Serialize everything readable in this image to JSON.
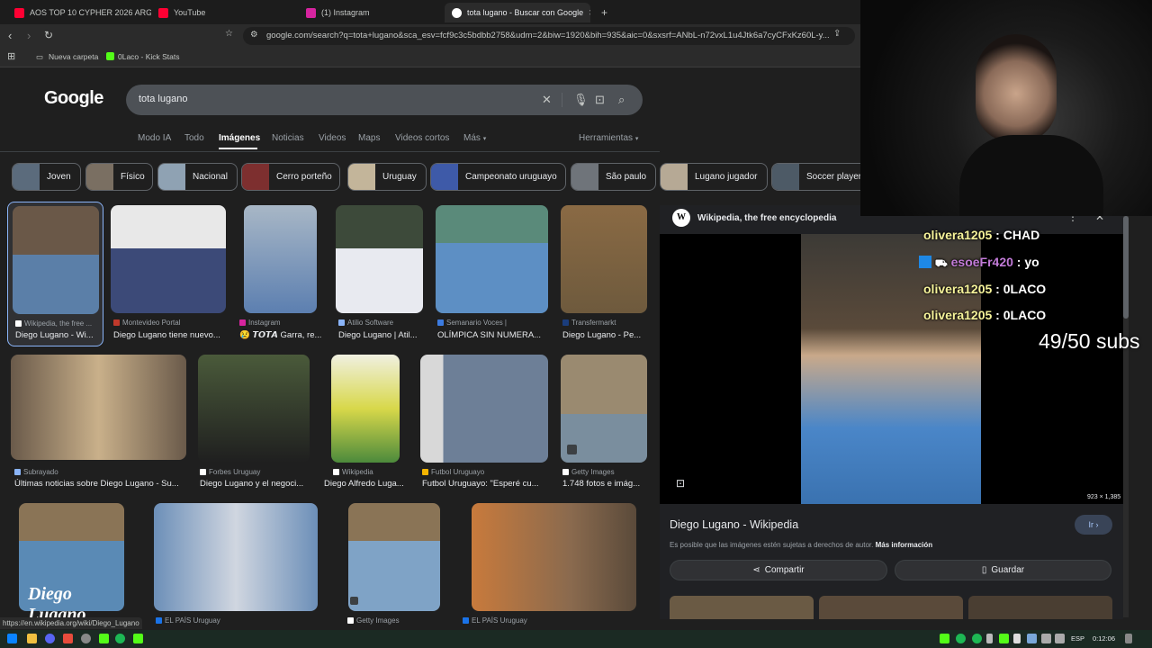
{
  "browser": {
    "tabs": [
      {
        "label": "AOS TOP 10 CYPHER 2026 ARG - You",
        "color": "#ff0033"
      },
      {
        "label": "YouTube",
        "color": "#ff0033"
      },
      {
        "label": "(1) Instagram",
        "color": "#d6249f"
      },
      {
        "label": "tota lugano - Buscar con Google",
        "color": "#ffffff"
      }
    ],
    "new_tab_icon": "+",
    "close_tab_icon": "✕",
    "url": "google.com/search?q=tota+lugano&sca_esv=fcf9c3c5bdbb2758&udm=2&biw=1920&bih=935&aic=0&sxsrf=ANbL-n72vxL1u4Jtk6a7cyCFxKz60L-y...",
    "bookmarks": [
      "Nueva carpeta",
      "0Laco - Kick Stats"
    ]
  },
  "google": {
    "logo": "Google",
    "query": "tota lugano",
    "nav_tabs": [
      "Modo IA",
      "Todo",
      "Imágenes",
      "Noticias",
      "Videos",
      "Maps",
      "Videos cortos",
      "Más"
    ],
    "tools": "Herramientas",
    "chips": [
      "Joven",
      "Físico",
      "Nacional",
      "Cerro porteño",
      "Uruguay",
      "Campeonato uruguayo",
      "São paulo",
      "Lugano jugador",
      "Soccer player"
    ]
  },
  "results": [
    {
      "source": "Wikipedia, the free ...",
      "caption": "Diego Lugano - Wi...",
      "color": "#5b7fa8"
    },
    {
      "source": "Montevideo Portal",
      "caption": "Diego Lugano tiene nuevo...",
      "color": "#3c4a78"
    },
    {
      "source": "Instagram",
      "caption": "😢 𝙏𝙊𝙏𝘼 Garra, re...",
      "color": "#5c7fb0"
    },
    {
      "source": "Atilio Software",
      "caption": "Diego Lugano | Atil...",
      "color": "#6a8fbf"
    },
    {
      "source": "Semanario Voces |",
      "caption": "OLÍMPICA SIN NUMERA...",
      "color": "#5d8fc4"
    },
    {
      "source": "Transfermarkt",
      "caption": "Diego Lugano - Pe...",
      "color": "#6e5a3d"
    },
    {
      "source": "Subrayado",
      "caption": "Últimas noticias sobre Diego Lugano - Su...",
      "color": "#9c8466"
    },
    {
      "source": "Forbes Uruguay",
      "caption": "Diego Lugano y el negoci...",
      "color": "#4a5a3a"
    },
    {
      "source": "Wikipedia",
      "caption": "Diego Alfredo Luga...",
      "color": "#4c8a3c"
    },
    {
      "source": "Futbol Uruguayo",
      "caption": "Futbol Uruguayo: \"Esperé cu...",
      "color": "#6d7f97"
    },
    {
      "source": "Getty Images",
      "caption": "1.748 fotos e imág...",
      "color": "#7a8e9e"
    },
    {
      "source": "",
      "caption": "",
      "color": "#5a8ab5",
      "overlay": "Diego Lugano"
    },
    {
      "source": "EL PAÍS Uruguay",
      "caption": "",
      "color": "#6c8fb8"
    },
    {
      "source": "Getty Images",
      "caption": "",
      "color": "#7fa3c6"
    },
    {
      "source": "EL PAÍS Uruguay",
      "caption": "",
      "color": "#8a6a4e"
    }
  ],
  "panel": {
    "site": "Wikipedia, the free encyclopedia",
    "dimensions": "923 × 1,385",
    "title": "Diego Lugano - Wikipedia",
    "go_label": "Ir",
    "copyright": "Es posible que las imágenes estén sujetas a derechos de autor.",
    "more_info": "Más información",
    "share_label": "Compartir",
    "save_label": "Guardar"
  },
  "chat": [
    {
      "user": "olivera1205",
      "msg": "CHAD"
    },
    {
      "user": "esoeFr420",
      "msg": "yo"
    },
    {
      "user": "olivera1205",
      "msg": "0LACO"
    },
    {
      "user": "olivera1205",
      "msg": "0LACO"
    }
  ],
  "overlay_subs": "49/50 subs",
  "status_url": "https://en.wikipedia.org/wiki/Diego_Lugano",
  "tray": {
    "lang": "ESP",
    "time": "0:12:06"
  }
}
